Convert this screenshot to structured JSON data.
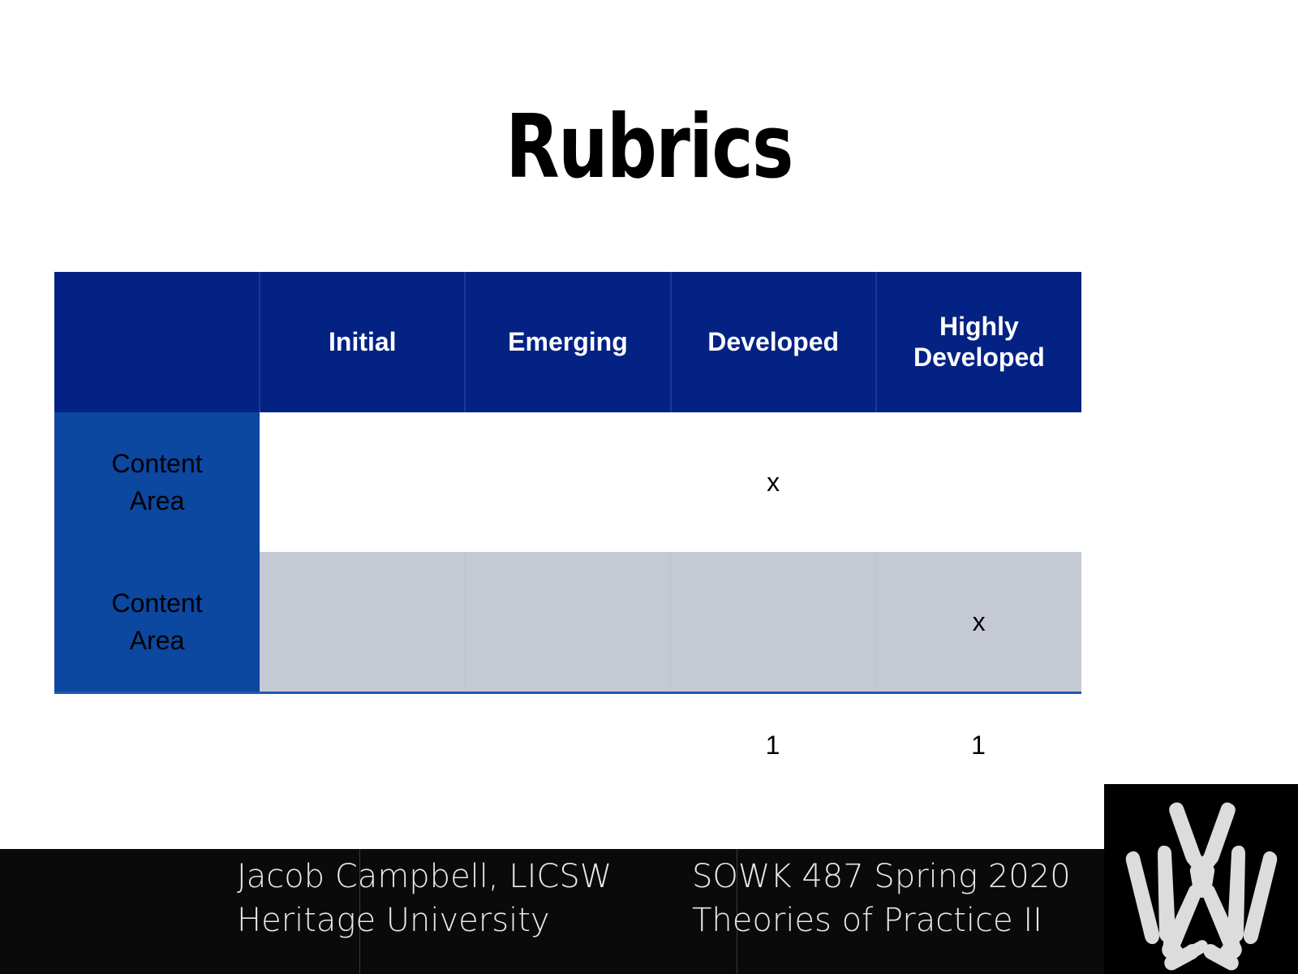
{
  "slide": {
    "title": "Rubrics",
    "background_color": "#ffffff"
  },
  "colors": {
    "header_navy": "#042284",
    "row_label_blue": "#0c47a0",
    "grey_row": "#c5c9d3",
    "footer_black": "#0a0a0a",
    "text_white": "#ffffff",
    "text_black": "#000000",
    "logo_light": "#dcdcdc",
    "table_bottom_rule": "#1e5bb0"
  },
  "table": {
    "corner_label": "",
    "columns": [
      {
        "label": "Initial"
      },
      {
        "label": "Emerging"
      },
      {
        "label": "Developed"
      },
      {
        "label": "Highly",
        "label2": "Developed"
      }
    ],
    "rows": [
      {
        "label_line1": "Content",
        "label_line2": "Area",
        "shaded": false,
        "cells": [
          "",
          "",
          "x",
          ""
        ]
      },
      {
        "label_line1": "Content",
        "label_line2": "Area",
        "shaded": true,
        "cells": [
          "",
          "",
          "",
          "x"
        ]
      }
    ],
    "totals": [
      "",
      "",
      "1",
      "1"
    ]
  },
  "footer": {
    "left": {
      "line1": "Jacob Campbell, LICSW",
      "line2": "Heritage University"
    },
    "right": {
      "line1": "SOWK 487 Spring 2020",
      "line2": "Theories of Practice II"
    }
  },
  "logo": {
    "name": "heritage-university-logo"
  }
}
